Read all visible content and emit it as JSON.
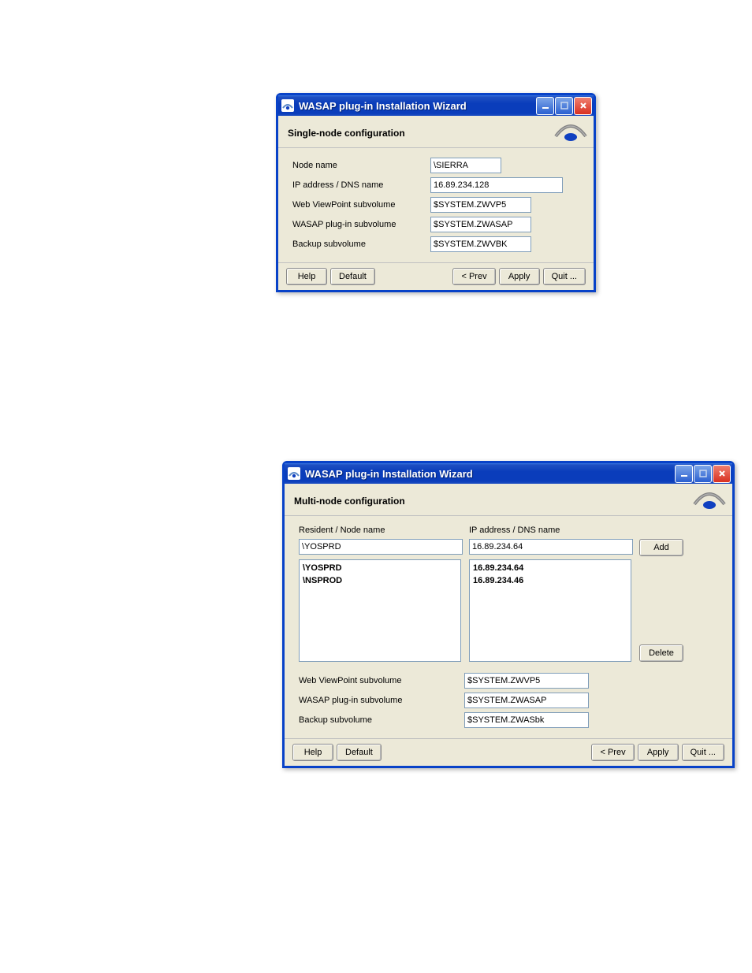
{
  "window": {
    "title": "WASAP plug-in Installation Wizard",
    "buttons": {
      "help": "Help",
      "default": "Default",
      "prev": "< Prev",
      "apply": "Apply",
      "quit": "Quit ..."
    }
  },
  "single": {
    "header": "Single-node configuration",
    "labels": {
      "node_name": "Node name",
      "ip": "IP address / DNS name",
      "wvp": "Web ViewPoint subvolume",
      "wasap": "WASAP plug-in subvolume",
      "backup": "Backup subvolume"
    },
    "values": {
      "node_name": "\\SIERRA",
      "ip": "16.89.234.128",
      "wvp": "$SYSTEM.ZWVP5",
      "wasap": "$SYSTEM.ZWASAP",
      "backup": "$SYSTEM.ZWVBK"
    }
  },
  "multi": {
    "header": "Multi-node configuration",
    "labels": {
      "resident": "Resident / Node name",
      "ip": "IP address / DNS name",
      "add": "Add",
      "delete": "Delete",
      "wvp": "Web ViewPoint subvolume",
      "wasap": "WASAP plug-in subvolume",
      "backup": "Backup subvolume"
    },
    "inputs": {
      "resident": "\\YOSPRD",
      "ip": "16.89.234.64"
    },
    "list_nodes": [
      "\\YOSPRD",
      "\\NSPROD"
    ],
    "list_ips": [
      "16.89.234.64",
      "16.89.234.46"
    ],
    "values": {
      "wvp": "$SYSTEM.ZWVP5",
      "wasap": "$SYSTEM.ZWASAP",
      "backup": "$SYSTEM.ZWASbk"
    }
  }
}
